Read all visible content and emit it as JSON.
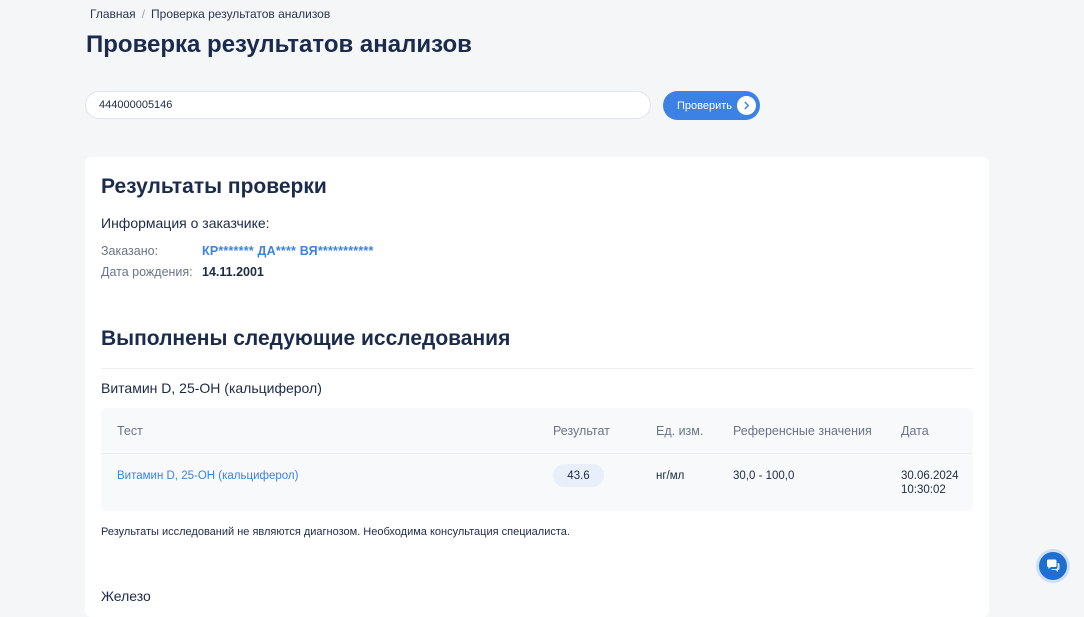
{
  "breadcrumb": {
    "home": "Главная",
    "separator": "/",
    "current": "Проверка результатов анализов"
  },
  "page_title": "Проверка результатов анализов",
  "search": {
    "value": "444000005146",
    "button_label": "Проверить",
    "button_icon": "chevron-right-icon"
  },
  "results": {
    "title": "Результаты проверки",
    "customer_heading": "Информация о заказчике:",
    "ordered_label": "Заказано:",
    "ordered_value": "КР******* ДА**** ВЯ***********",
    "birth_label": "Дата рождения:",
    "birth_value": "14.11.2001"
  },
  "studies": {
    "title": "Выполнены следующие исследования",
    "study_name": "Витамин D, 25-OH (кальциферол)",
    "columns": {
      "test": "Тест",
      "result": "Результат",
      "unit": "Ед. изм.",
      "reference": "Референсные значения",
      "date": "Дата"
    },
    "rows": [
      {
        "test": "Витамин D, 25-OH (кальциферол)",
        "result": "43.6",
        "unit": "нг/мл",
        "reference": "30,0 - 100,0",
        "date": "30.06.2024",
        "time": "10:30:02"
      }
    ],
    "disclaimer": "Результаты исследований не являются диагнозом. Необходима консультация специалиста.",
    "next_study": "Железо"
  },
  "chat": {
    "icon": "chat-icon"
  },
  "colors": {
    "accent": "#3b82e4",
    "title": "#1a2b4e",
    "background": "#f5f6f8"
  }
}
